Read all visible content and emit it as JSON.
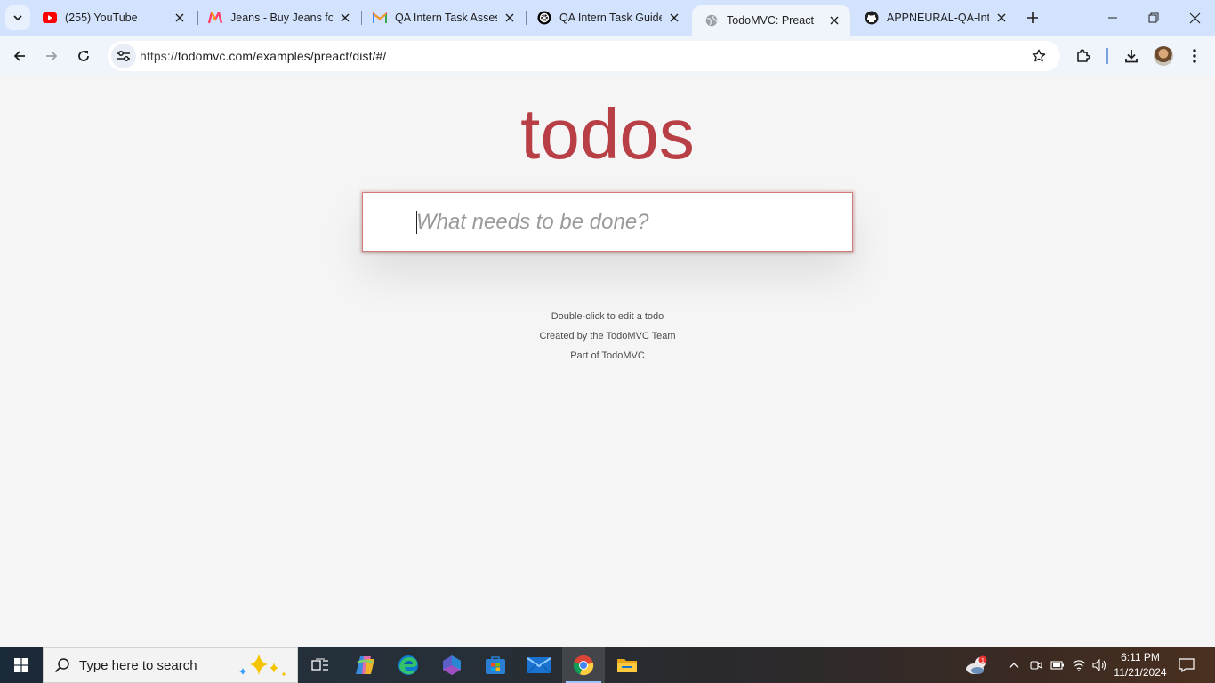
{
  "browser": {
    "tabs": [
      {
        "title": "(255) YouTube",
        "icon": "youtube-icon"
      },
      {
        "title": "Jeans - Buy Jeans for",
        "icon": "myntra-icon"
      },
      {
        "title": "QA Intern Task Assess",
        "icon": "gmail-icon"
      },
      {
        "title": "QA Intern Task Guide",
        "icon": "chatgpt-icon"
      },
      {
        "title": "TodoMVC: Preact",
        "icon": "globe-icon",
        "active": true
      },
      {
        "title": "APPNEURAL-QA-Inte",
        "icon": "github-icon"
      }
    ],
    "url_scheme": "https://",
    "url_rest": "todomvc.com/examples/preact/dist/#/"
  },
  "app": {
    "title": "todos",
    "new_todo_placeholder": "What needs to be done?",
    "new_todo_value": "",
    "info": [
      "Double-click to edit a todo",
      "Created by the TodoMVC Team",
      "Part of TodoMVC"
    ],
    "accent_color": "#b83f45"
  },
  "taskbar": {
    "search_placeholder": "Type here to search",
    "apps": [
      "task-view-icon",
      "copilot-icon",
      "edge-icon",
      "m365-icon",
      "store-icon",
      "mail-icon",
      "chrome-icon",
      "file-explorer-icon"
    ],
    "active_app": "chrome-icon",
    "weather_badge": "1",
    "time": "6:11 PM",
    "date": "11/21/2024"
  }
}
